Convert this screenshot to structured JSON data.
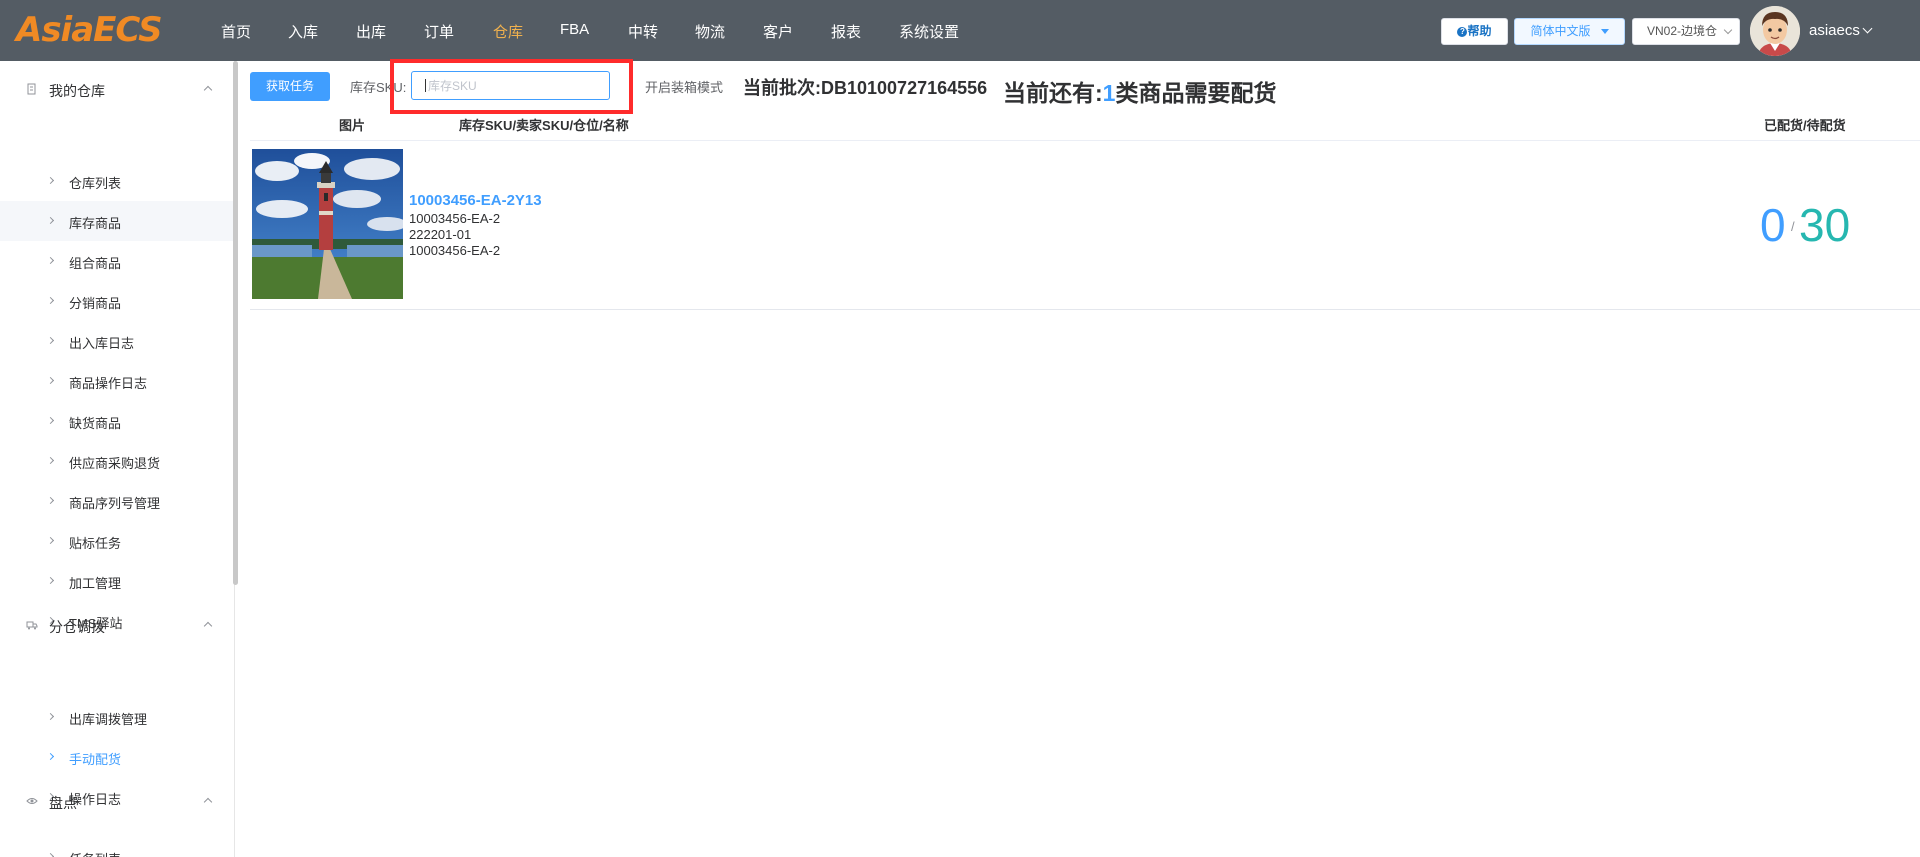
{
  "header": {
    "logo": "AsiaECS",
    "nav": [
      {
        "label": "首页",
        "active": false
      },
      {
        "label": "入库",
        "active": false
      },
      {
        "label": "出库",
        "active": false
      },
      {
        "label": "订单",
        "active": false
      },
      {
        "label": "仓库",
        "active": true
      },
      {
        "label": "FBA",
        "active": false
      },
      {
        "label": "中转",
        "active": false
      },
      {
        "label": "物流",
        "active": false
      },
      {
        "label": "客户",
        "active": false
      },
      {
        "label": "报表",
        "active": false
      },
      {
        "label": "系统设置",
        "active": false
      }
    ],
    "help_label": "帮助",
    "language": "简体中文版",
    "warehouse": "VN02-边境仓",
    "username": "asiaecs"
  },
  "sidebar": {
    "groups": [
      {
        "title": "我的仓库",
        "icon": "warehouse-icon",
        "items": [
          "仓库列表",
          "库存商品",
          "组合商品",
          "分销商品",
          "出入库日志",
          "商品操作日志",
          "缺货商品",
          "供应商采购退货",
          "商品序列号管理",
          "贴标任务",
          "加工管理",
          "TMS驿站"
        ]
      },
      {
        "title": "分仓调拨",
        "icon": "truck-icon",
        "items": [
          "出库调拨管理",
          "手动配货",
          "操作日志"
        ]
      },
      {
        "title": "盘点",
        "icon": "eye-icon",
        "items": [
          "任务列表"
        ]
      }
    ],
    "active_item": "手动配货",
    "hover_item": "库存商品"
  },
  "toolbar": {
    "fetch_button": "获取任务",
    "sku_label": "库存SKU:",
    "sku_placeholder": "库存SKU",
    "sku_value": "",
    "box_mode_label": "开启装箱模式",
    "batch_prefix": "当前批次:",
    "batch_no": "DB10100727164556",
    "remain_prefix": "当前还有:",
    "remain_count": "1",
    "remain_suffix": "类商品需要配货"
  },
  "table": {
    "headers": {
      "image": "图片",
      "sku_info": "库存SKU/卖家SKU/仓位/名称",
      "progress": "已配货/待配货"
    },
    "rows": [
      {
        "stock_sku": "10003456-EA-2Y13",
        "seller_sku": "10003456-EA-2",
        "location": "222201-01",
        "name": "10003456-EA-2",
        "allocated": "0",
        "separator": "/",
        "pending": "30"
      }
    ]
  }
}
